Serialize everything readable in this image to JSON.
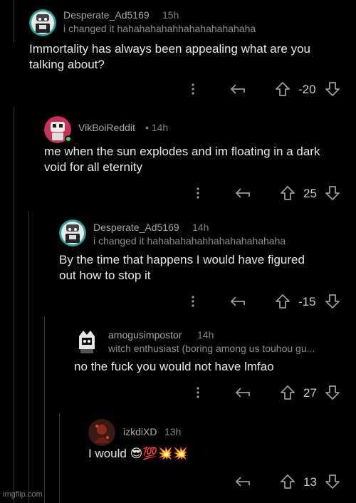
{
  "comments": [
    {
      "username": "Desperate_Ad5169",
      "time": "15h",
      "flair": "i changed it hahahahahahhahahahahahaha",
      "body_lines": [
        "Immortality has always been appealing what are you",
        "talking about?"
      ],
      "score": "-20"
    },
    {
      "username": "VikBoiReddit",
      "time": "• 14h",
      "flair": "",
      "body_lines": [
        "me when the sun explodes and im floating in a dark",
        "void for all eternity"
      ],
      "score": "25"
    },
    {
      "username": "Desperate_Ad5169",
      "time": "14h",
      "flair": "i changed it hahahahahahhahahahahahaha",
      "body_lines": [
        "By the time that happens I would have figured",
        "out how to stop it"
      ],
      "score": "-15"
    },
    {
      "username": "amogusimpostor",
      "time": "14h",
      "flair": "witch enthusiast (boring among us touhou gu...",
      "body_lines": [
        "no the fuck you would not have lmfao"
      ],
      "score": "27"
    },
    {
      "username": "izkdiXD",
      "time": "13h",
      "flair": "",
      "body_lines": [
        "I would 😎💯💥💥"
      ],
      "score": "13"
    }
  ],
  "icons": {
    "more": "more-vertical-icon",
    "reply": "reply-arrow-icon",
    "upvote": "upvote-arrow-icon",
    "downvote": "downvote-arrow-icon"
  },
  "watermark": "imgflip.com"
}
